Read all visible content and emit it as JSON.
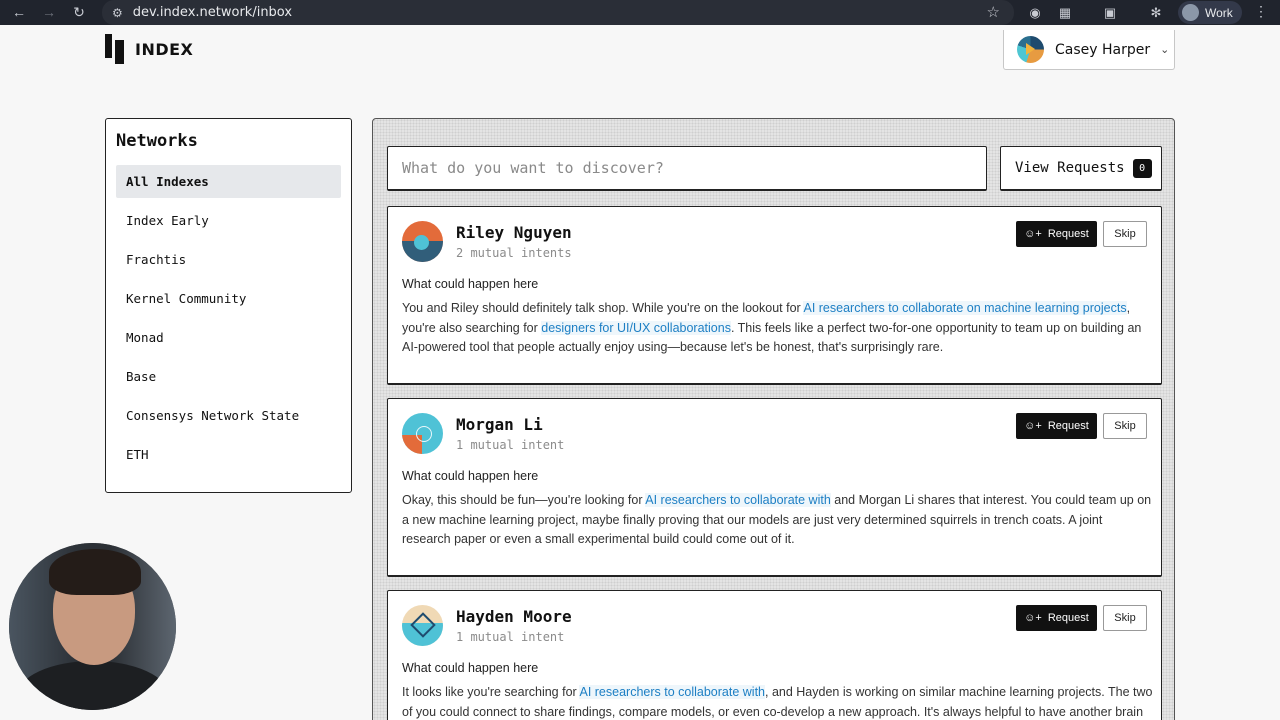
{
  "browser": {
    "url": "dev.index.network/inbox",
    "profile_name": "Work"
  },
  "header": {
    "logo_text": "INDEX",
    "user_name": "Casey Harper"
  },
  "sidebar": {
    "title": "Networks",
    "items": [
      {
        "label": "All Indexes",
        "active": true
      },
      {
        "label": "Index Early"
      },
      {
        "label": "Frachtis"
      },
      {
        "label": "Kernel Community"
      },
      {
        "label": "Monad"
      },
      {
        "label": "Base"
      },
      {
        "label": "Consensys Network State"
      },
      {
        "label": "ETH"
      }
    ]
  },
  "main": {
    "search_placeholder": "What do you want to discover?",
    "view_requests_label": "View Requests",
    "view_requests_count": "0",
    "request_label": "Request",
    "skip_label": "Skip",
    "what_label": "What could happen here",
    "cards": [
      {
        "name": "Riley Nguyen",
        "mutual": "2 mutual intents",
        "text": [
          {
            "t": "You and Riley should definitely talk shop. While you're on the lookout for "
          },
          {
            "t": "AI researchers to collaborate on machine learning projects",
            "hl": true
          },
          {
            "t": ", you're also searching for "
          },
          {
            "t": "designers for UI/UX collaborations",
            "hl": true
          },
          {
            "t": ". This feels like a perfect two-for-one opportunity to team up on building an AI-powered tool that people actually enjoy using—because let's be honest, that's surprisingly rare."
          }
        ]
      },
      {
        "name": "Morgan Li",
        "mutual": "1 mutual intent",
        "text": [
          {
            "t": "Okay, this should be fun—you're looking for "
          },
          {
            "t": "AI researchers to collaborate with",
            "hl": true
          },
          {
            "t": " and Morgan Li shares that interest. You could team up on a new machine learning project, maybe finally proving that our models are just very determined squirrels in trench coats. A joint research paper or even a small experimental build could come out of it."
          }
        ]
      },
      {
        "name": "Hayden Moore",
        "mutual": "1 mutual intent",
        "text": [
          {
            "t": "It looks like you're searching for "
          },
          {
            "t": "AI researchers to collaborate with",
            "hl": true
          },
          {
            "t": ", and Hayden is working on similar machine learning projects. The two of you could connect to share findings, compare models, or even co-develop a new approach. It's always helpful to have another brain in"
          }
        ]
      }
    ]
  },
  "colors": {
    "accent_link": "#1d7fc4",
    "button_dark": "#111111",
    "chrome_bg": "#20242d"
  }
}
